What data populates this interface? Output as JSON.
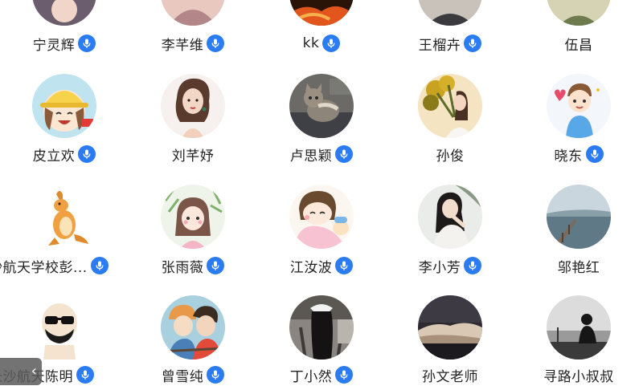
{
  "contacts": [
    {
      "name": "宁灵辉",
      "voice": true,
      "avatar": "partial-avatar-icon"
    },
    {
      "name": "李芊维",
      "voice": true,
      "avatar": "partial-avatar-icon"
    },
    {
      "name": "kk",
      "voice": true,
      "avatar": "partial-avatar-icon"
    },
    {
      "name": "王榴卉",
      "voice": true,
      "avatar": "partial-avatar-icon"
    },
    {
      "name": "伍昌",
      "voice": false,
      "avatar": "partial-avatar-icon"
    },
    {
      "name": "皮立欢",
      "voice": true,
      "avatar": "cartoon-girl-hat-icon"
    },
    {
      "name": "刘芊妤",
      "voice": false,
      "avatar": "illustrated-woman-icon"
    },
    {
      "name": "卢思颖",
      "voice": true,
      "avatar": "cat-photo-icon"
    },
    {
      "name": "孙俊",
      "voice": false,
      "avatar": "girl-with-flowers-icon"
    },
    {
      "name": "晓东",
      "voice": true,
      "avatar": "cartoon-boy-heart-icon"
    },
    {
      "name": "沙航天学校彭...",
      "voice": true,
      "avatar": "kangaroo-icon"
    },
    {
      "name": "张雨薇",
      "voice": true,
      "avatar": "cartoon-girl-plants-icon"
    },
    {
      "name": "江汝波",
      "voice": true,
      "avatar": "cartoon-kids-icon"
    },
    {
      "name": "李小芳",
      "voice": true,
      "avatar": "woman-portrait-icon"
    },
    {
      "name": "邬艳红",
      "voice": false,
      "avatar": "pier-landscape-icon"
    },
    {
      "name": "长沙航天陈明",
      "voice": true,
      "avatar": "bald-man-sunglasses-icon"
    },
    {
      "name": "曾雪纯",
      "voice": true,
      "avatar": "anime-couple-icon"
    },
    {
      "name": "丁小然",
      "voice": true,
      "avatar": "girl-back-view-icon"
    },
    {
      "name": "孙文老师",
      "voice": false,
      "avatar": "clouds-landscape-icon"
    },
    {
      "name": "寻路小叔叔",
      "voice": false,
      "avatar": "silhouette-sea-icon"
    }
  ],
  "left_tab": {
    "label": "‹"
  },
  "colors": {
    "voice_badge": "#2b7cf2",
    "name_text": "#222222"
  }
}
